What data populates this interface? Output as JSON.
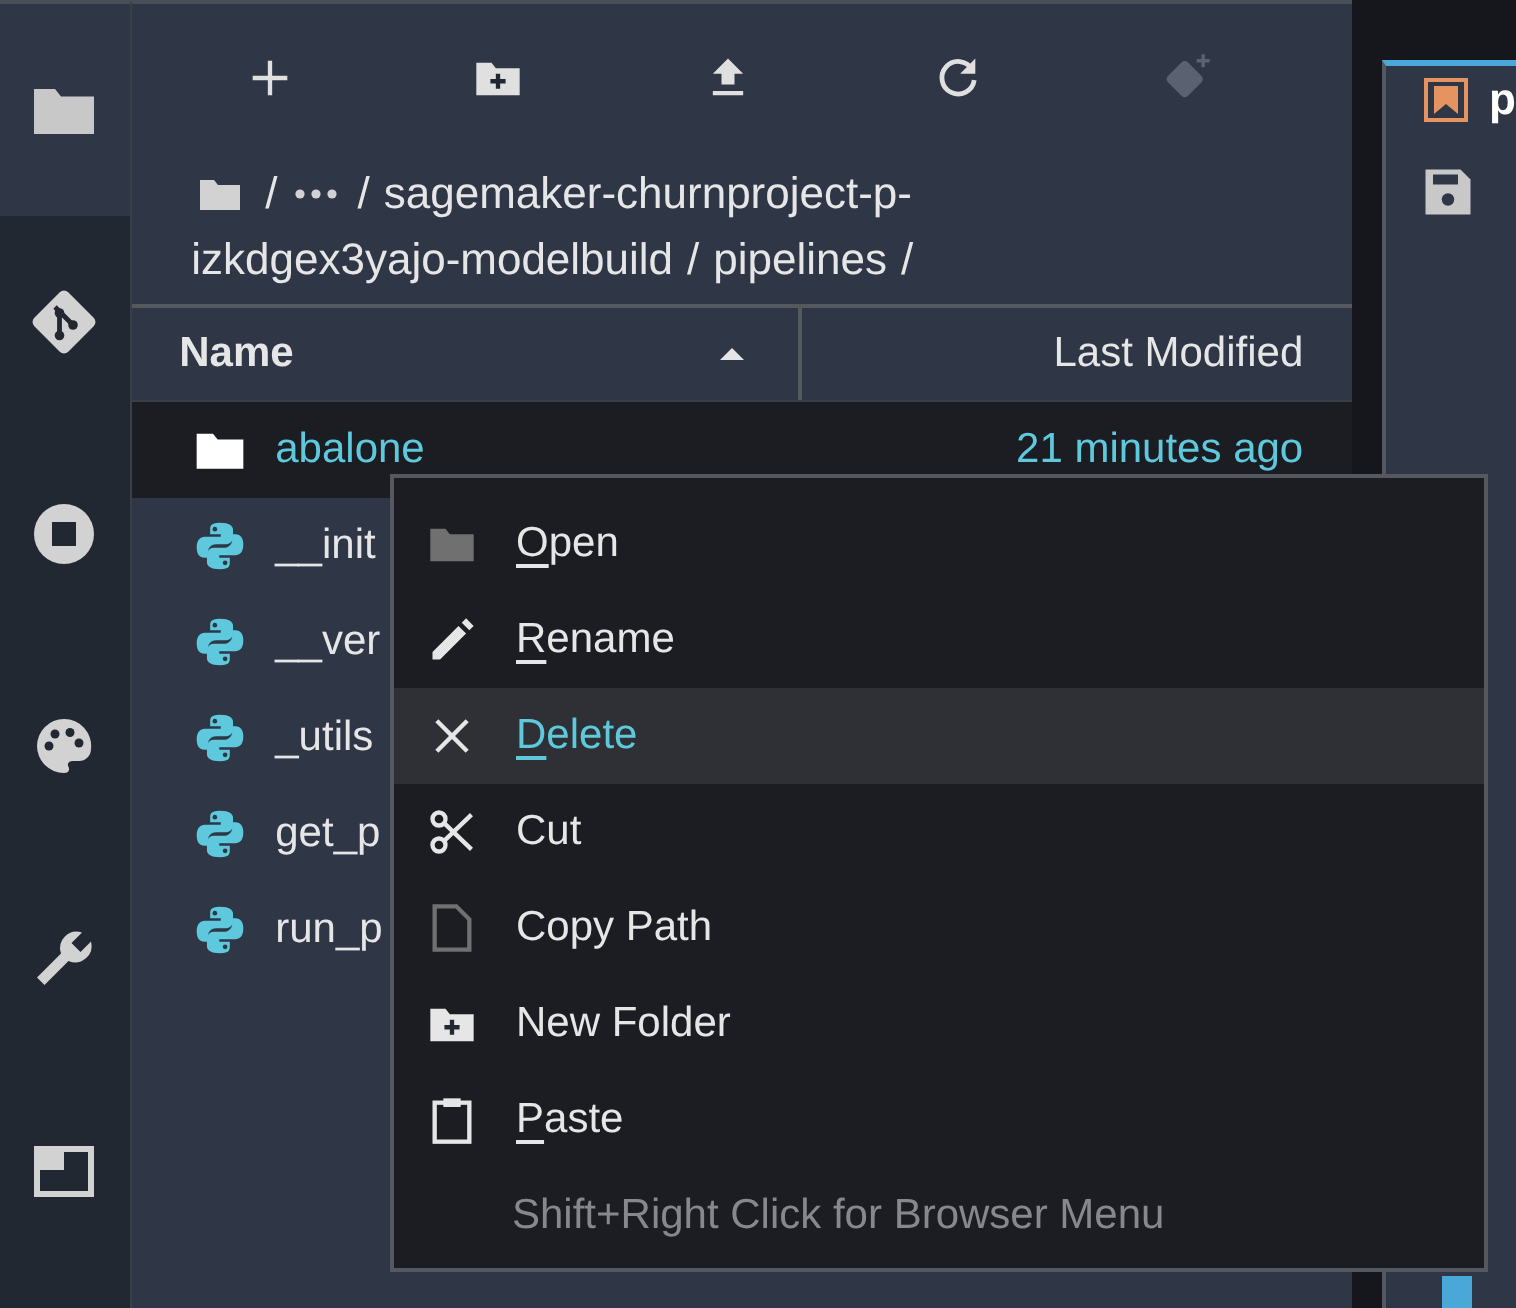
{
  "activity_bar": {
    "tabs": [
      {
        "kind": "folder",
        "selected": true
      },
      {
        "kind": "git",
        "selected": false
      },
      {
        "kind": "stop",
        "selected": false
      },
      {
        "kind": "palette",
        "selected": false
      },
      {
        "kind": "wrench",
        "selected": false
      },
      {
        "kind": "window",
        "selected": false
      }
    ]
  },
  "toolbar": {
    "buttons": [
      {
        "kind": "plus",
        "disabled": false
      },
      {
        "kind": "new-folder",
        "disabled": false
      },
      {
        "kind": "upload",
        "disabled": false
      },
      {
        "kind": "refresh",
        "disabled": false
      },
      {
        "kind": "git-clone",
        "disabled": true
      }
    ]
  },
  "breadcrumb": {
    "lines": [
      [
        {
          "kind": "root"
        },
        {
          "kind": "sep",
          "text": "/"
        },
        {
          "kind": "ellipsis"
        },
        {
          "kind": "sep",
          "text": "/"
        },
        {
          "kind": "dir",
          "text": "sagemaker-churnproject-p-"
        }
      ],
      [
        {
          "kind": "dir",
          "text": "izkdgex3yajo-modelbuild"
        },
        {
          "kind": "sep",
          "text": "/"
        },
        {
          "kind": "dir",
          "text": "pipelines"
        },
        {
          "kind": "sep",
          "text": "/"
        }
      ]
    ]
  },
  "table": {
    "columns": [
      {
        "label": "Name",
        "sorted": true
      },
      {
        "label": "Last Modified",
        "sorted": false
      }
    ],
    "rows": [
      {
        "kind": "folder",
        "name": "abalone",
        "modified": "21 minutes ago",
        "selected": true
      },
      {
        "kind": "python",
        "name": "__init",
        "selected": false
      },
      {
        "kind": "python",
        "name": "__ver",
        "selected": false
      },
      {
        "kind": "python",
        "name": "_utils",
        "selected": false
      },
      {
        "kind": "python",
        "name": "get_p",
        "selected": false
      },
      {
        "kind": "python",
        "name": "run_p",
        "selected": false
      }
    ]
  },
  "context_menu": {
    "items": [
      {
        "kind": "folder",
        "label": "Open",
        "mnemonic": true,
        "hovered": false
      },
      {
        "kind": "pencil",
        "label": "Rename",
        "mnemonic": true,
        "hovered": false
      },
      {
        "kind": "close",
        "label": "Delete",
        "mnemonic": true,
        "hovered": true
      },
      {
        "kind": "scissors",
        "label": "Cut",
        "mnemonic": false,
        "hovered": false
      },
      {
        "kind": "file",
        "label": "Copy Path",
        "mnemonic": false,
        "hovered": false
      },
      {
        "kind": "new-folder",
        "label": "New Folder",
        "mnemonic": false,
        "hovered": false
      },
      {
        "kind": "clipboard",
        "label": "Paste",
        "mnemonic": true,
        "hovered": false
      }
    ],
    "hint": "Shift+Right Click for Browser Menu"
  },
  "editor": {
    "tab_title": "p"
  }
}
